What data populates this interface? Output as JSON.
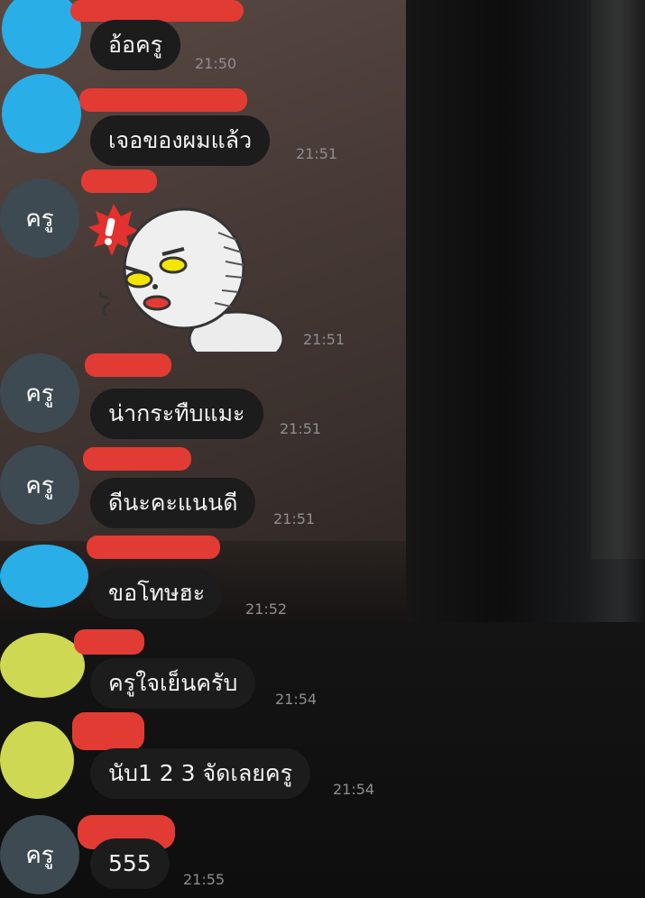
{
  "messages": [
    {
      "avatar_text": "",
      "text": "อ้อครู",
      "time": "21:50"
    },
    {
      "avatar_text": "",
      "text": "เจอของผมแล้ว",
      "time": "21:51"
    },
    {
      "avatar_text": "ครู",
      "text": "",
      "sticker": "angry-moon-sticker",
      "time": "21:51"
    },
    {
      "avatar_text": "ครู",
      "text": "น่ากระทืบแมะ",
      "time": "21:51"
    },
    {
      "avatar_text": "ครู",
      "text": "ดีนะคะแนนดี",
      "time": "21:51"
    },
    {
      "avatar_text": "",
      "text": "ขอโทษฮะ",
      "time": "21:52"
    },
    {
      "avatar_text": "",
      "text": "ครูใจเย็นครับ",
      "time": "21:54"
    },
    {
      "avatar_text": "",
      "text": "นับ1 2 3 จัดเลยครู",
      "time": "21:54"
    },
    {
      "avatar_text": "ครู",
      "text": "555",
      "time": "21:55"
    }
  ],
  "colors": {
    "avatar_blue": "#29aee8",
    "avatar_slate": "#3d4a52",
    "avatar_lime": "#cfd853",
    "redaction": "#e23b34",
    "bubble": "#1c1c1d"
  }
}
